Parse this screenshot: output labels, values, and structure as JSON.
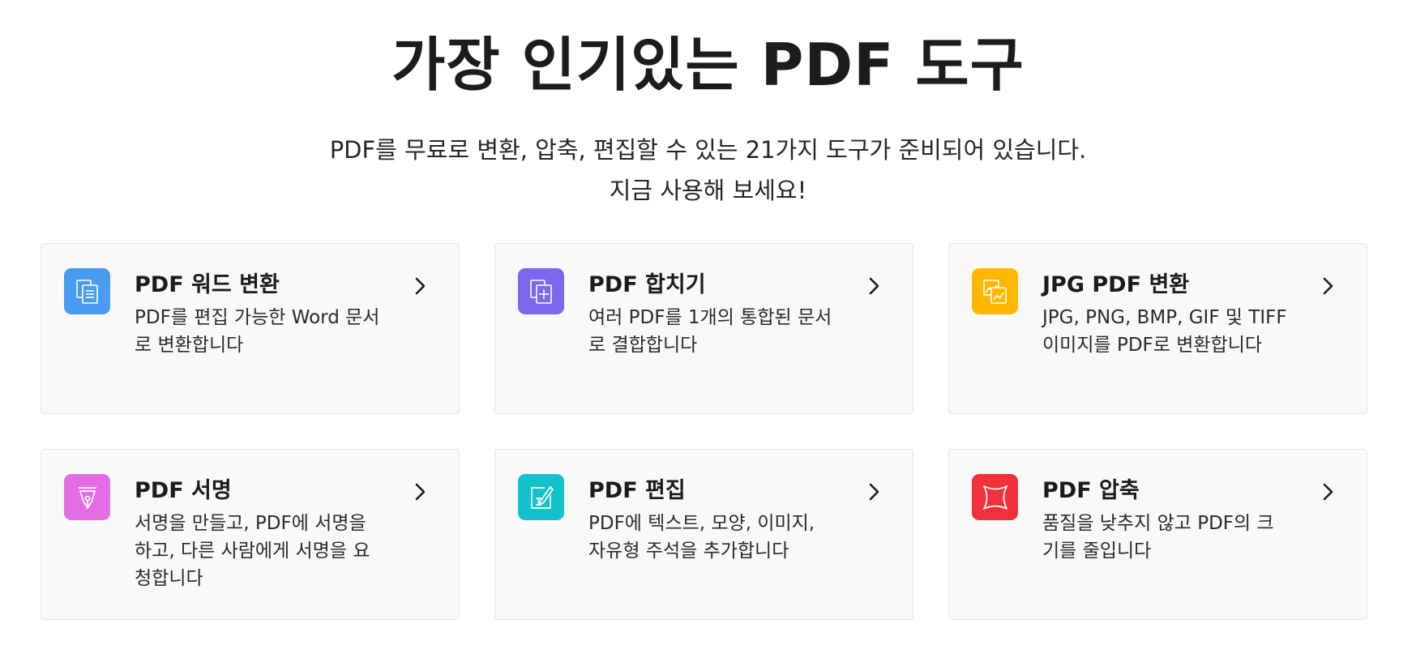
{
  "hero": {
    "title": "가장 인기있는 PDF 도구",
    "subtitle_line1": "PDF를 무료로 변환, 압축, 편집할 수 있는 21가지 도구가 준비되어 있습니다.",
    "subtitle_line2": "지금 사용해 보세요!"
  },
  "tools": [
    {
      "title": "PDF 워드 변환",
      "desc": "PDF를 편집 가능한 Word 문서로 변환합니다",
      "icon": "pdf-to-word-icon",
      "color": "#4a9cf0"
    },
    {
      "title": "PDF 합치기",
      "desc": "여러 PDF를 1개의 통합된 문서로 결합합니다",
      "icon": "merge-pdf-icon",
      "color": "#7b68ee"
    },
    {
      "title": "JPG PDF 변환",
      "desc": "JPG, PNG, BMP, GIF 및 TIFF 이미지를 PDF로 변환합니다",
      "icon": "image-to-pdf-icon",
      "color": "#ffb800"
    },
    {
      "title": "PDF 서명",
      "desc": "서명을 만들고, PDF에 서명을 하고, 다른 사람에게 서명을 요청합니다",
      "icon": "pen-nib-icon",
      "color": "#e36ce4"
    },
    {
      "title": "PDF 편집",
      "desc": "PDF에 텍스트, 모양, 이미지, 자유형 주석을 추가합니다",
      "icon": "edit-pdf-icon",
      "color": "#13c3cc"
    },
    {
      "title": "PDF 압축",
      "desc": "품질을 낮추지 않고 PDF의 크기를 줄입니다",
      "icon": "compress-pdf-icon",
      "color": "#f0303a"
    }
  ]
}
